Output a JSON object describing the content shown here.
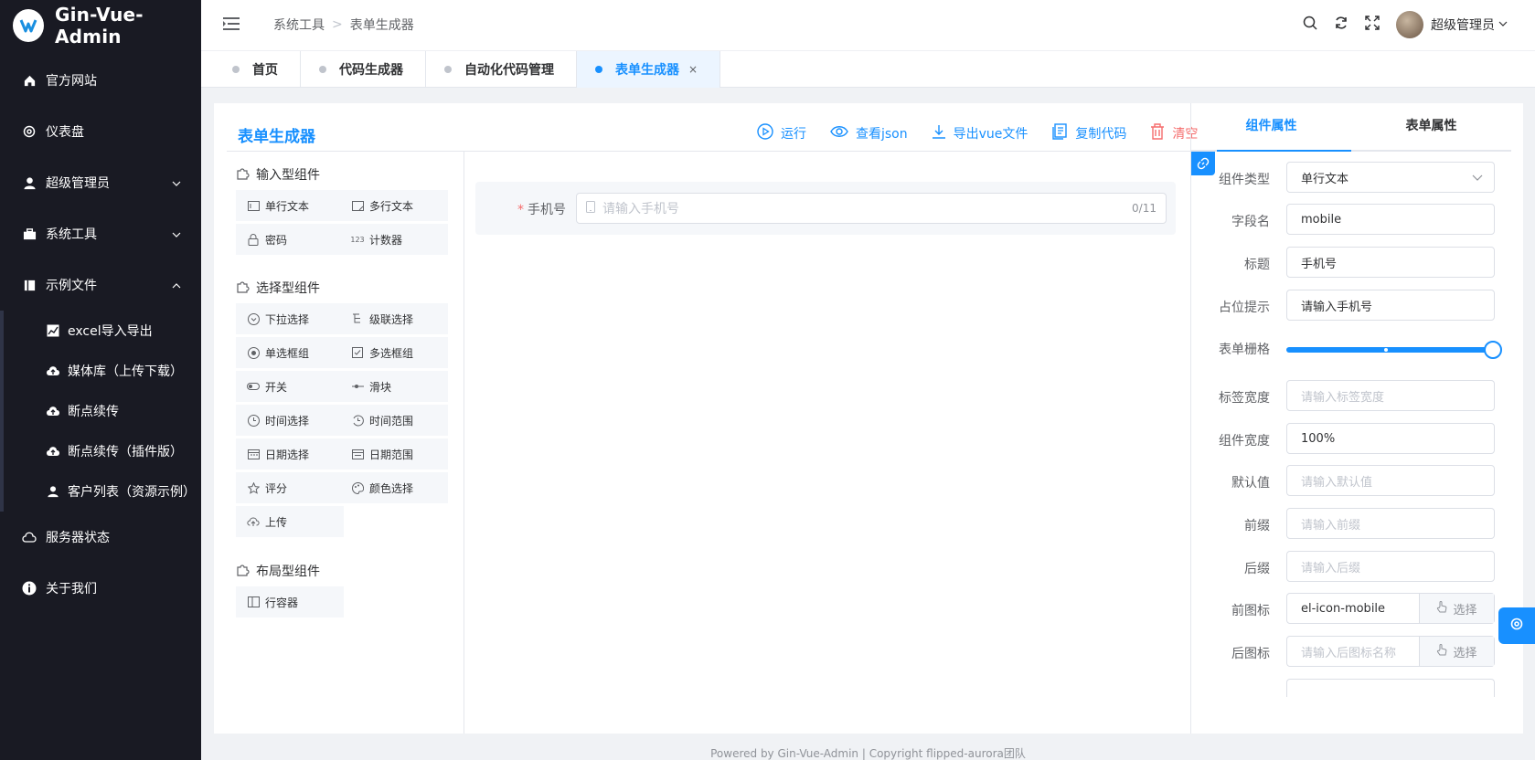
{
  "brand": {
    "title": "Gin-Vue-Admin"
  },
  "sidebar": {
    "items": [
      {
        "label": "官方网站",
        "icon": "home-icon"
      },
      {
        "label": "仪表盘",
        "icon": "gear-icon"
      },
      {
        "label": "超级管理员",
        "icon": "user-icon",
        "expandable": true
      },
      {
        "label": "系统工具",
        "icon": "toolbox-icon",
        "expandable": true
      },
      {
        "label": "示例文件",
        "icon": "book-icon",
        "expanded": true
      },
      {
        "label": "服务器状态",
        "icon": "cloud-icon"
      },
      {
        "label": "关于我们",
        "icon": "info-icon"
      }
    ],
    "sub_items": [
      {
        "label": "excel导入导出",
        "icon": "chart-icon"
      },
      {
        "label": "媒体库（上传下载）",
        "icon": "cloud-upload-icon"
      },
      {
        "label": "断点续传",
        "icon": "cloud-upload-icon"
      },
      {
        "label": "断点续传（插件版）",
        "icon": "cloud-upload-icon"
      },
      {
        "label": "客户列表（资源示例）",
        "icon": "user-icon"
      }
    ]
  },
  "header": {
    "breadcrumb": [
      "系统工具",
      "表单生成器"
    ],
    "user_name": "超级管理员"
  },
  "tabs": [
    {
      "label": "首页",
      "active": false
    },
    {
      "label": "代码生成器",
      "active": false
    },
    {
      "label": "自动化代码管理",
      "active": false
    },
    {
      "label": "表单生成器",
      "active": true,
      "close": "×"
    }
  ],
  "main": {
    "title": "表单生成器",
    "toolbar": {
      "run": "运行",
      "view_json": "查看json",
      "export_vue": "导出vue文件",
      "copy_code": "复制代码",
      "clear": "清空"
    }
  },
  "components": {
    "input_group": {
      "title": "输入型组件",
      "items": [
        "单行文本",
        "多行文本",
        "密码",
        "计数器"
      ]
    },
    "select_group": {
      "title": "选择型组件",
      "items": [
        "下拉选择",
        "级联选择",
        "单选框组",
        "多选框组",
        "开关",
        "滑块",
        "时间选择",
        "时间范围",
        "日期选择",
        "日期范围",
        "评分",
        "颜色选择",
        "上传"
      ]
    },
    "layout_group": {
      "title": "布局型组件",
      "items": [
        "行容器"
      ]
    }
  },
  "canvas": {
    "field": {
      "required_mark": "*",
      "label": "手机号",
      "placeholder": "请输入手机号",
      "count": "0/11"
    }
  },
  "properties": {
    "tabs": [
      "组件属性",
      "表单属性"
    ],
    "active_tab": 0,
    "fields": [
      {
        "label": "组件类型",
        "value": "单行文本",
        "type": "select"
      },
      {
        "label": "字段名",
        "value": "mobile"
      },
      {
        "label": "标题",
        "value": "手机号"
      },
      {
        "label": "占位提示",
        "value": "请输入手机号"
      },
      {
        "label": "表单栅格",
        "type": "slider",
        "value_fraction": 1.0
      },
      {
        "label": "标签宽度",
        "placeholder": "请输入标签宽度"
      },
      {
        "label": "组件宽度",
        "value": "100%"
      },
      {
        "label": "默认值",
        "placeholder": "请输入默认值"
      },
      {
        "label": "前缀",
        "placeholder": "请输入前缀"
      },
      {
        "label": "后缀",
        "placeholder": "请输入后缀"
      },
      {
        "label": "前图标",
        "value": "el-icon-mobile",
        "append": "选择"
      },
      {
        "label": "后图标",
        "placeholder": "请输入后图标名称",
        "append": "选择"
      }
    ]
  },
  "footer": {
    "text": "Powered by Gin-Vue-Admin | Copyright flipped-aurora团队"
  },
  "colors": {
    "accent": "#1890ff",
    "danger": "#f56c6c",
    "sidebar_bg": "#191a23"
  }
}
